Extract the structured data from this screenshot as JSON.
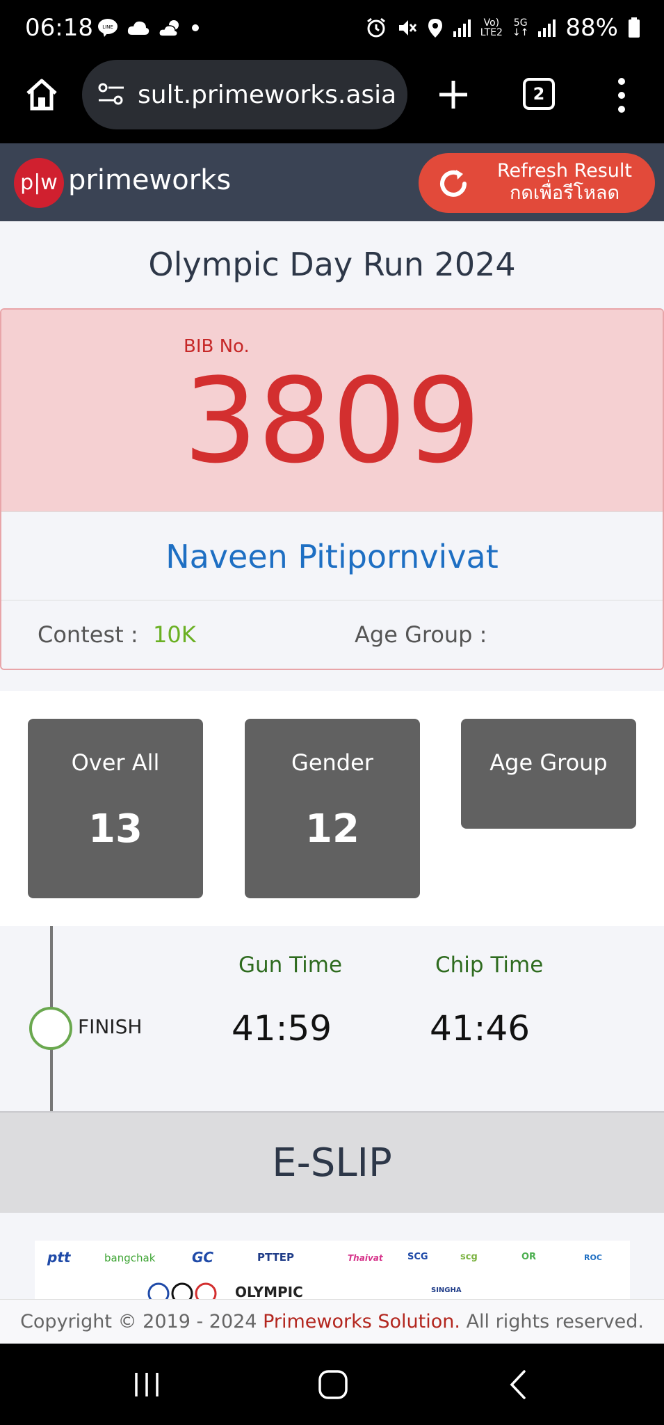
{
  "status_bar": {
    "time": "06:18",
    "network_label_top": "Vo)",
    "network_label_bottom": "LTE2",
    "fiveg_label": "5G",
    "battery": "88%",
    "left_icons": [
      "line-icon",
      "cloud-icon",
      "weather-icon",
      "dot-icon"
    ],
    "right_icons": [
      "alarm-icon",
      "mute-icon",
      "location-icon",
      "signal-icon",
      "battery-icon"
    ]
  },
  "browser": {
    "url": "sult.primeworks.asia",
    "tab_count": "2"
  },
  "site_header": {
    "logo_mark": "p|w",
    "logo_text": "primeworks",
    "refresh_line1": "Refresh Result",
    "refresh_line2": "กดเพื่อรีโหลด"
  },
  "event": {
    "title": "Olympic Day Run 2024"
  },
  "bib": {
    "label": "BIB No.",
    "number": "3809"
  },
  "runner": {
    "name": "Naveen Pitipornvivat",
    "contest_label": "Contest :",
    "contest_value": "10K",
    "age_group_label": "Age Group :"
  },
  "ranks": {
    "overall_label": "Over All",
    "overall_value": "13",
    "gender_label": "Gender",
    "gender_value": "12",
    "age_group_label": "Age Group"
  },
  "timeline": {
    "checkpoint": "FINISH",
    "gun_time_label": "Gun Time",
    "gun_time": "41:59",
    "chip_time_label": "Chip Time",
    "chip_time": "41:46"
  },
  "eslip": {
    "label": "E-SLIP"
  },
  "sponsors": {
    "row1": [
      "ptt",
      "bangchak",
      "GC",
      "PTTEP",
      "Thaivat",
      "SCG",
      "scg",
      "OR",
      "ROC"
    ],
    "row2": [
      "OLYMPIC",
      "SINGHA"
    ]
  },
  "footer": {
    "prefix": "Copyright © 2019 - 2024",
    "brand": "Primeworks Solution.",
    "suffix": "All rights reserved."
  },
  "colors": {
    "header_bg": "#3a4354",
    "refresh_bg": "#e24a3a",
    "bib_bg": "#f5d0d2",
    "bib_number": "#d32f2f",
    "runner_name": "#1e6fc3",
    "contest_value": "#6ab023",
    "rank_box": "#616161",
    "timeline_dot": "#6aa84f"
  }
}
